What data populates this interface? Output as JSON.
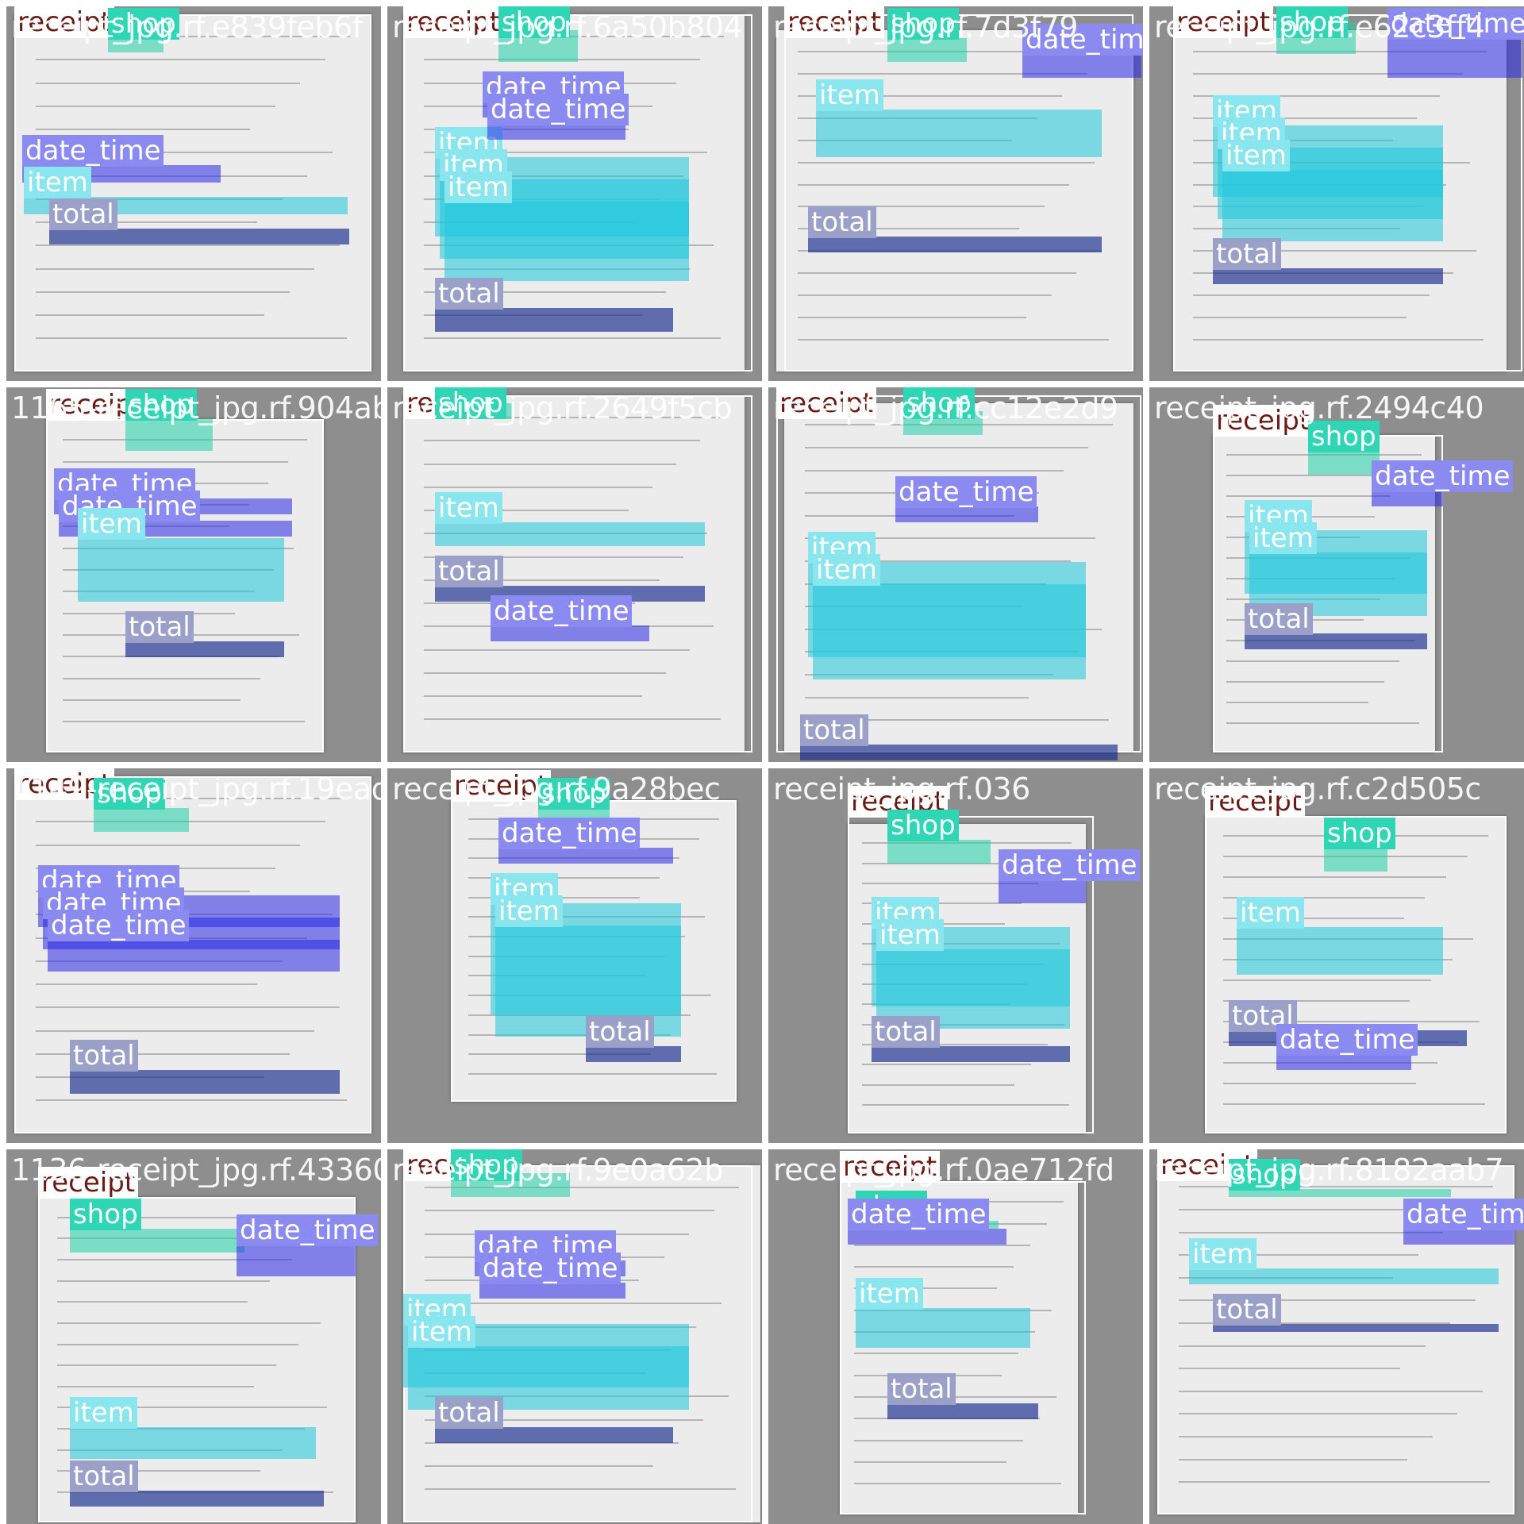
{
  "colors": {
    "receipt": "#ffffff",
    "shop": "#2fd6b6",
    "date_time": "#2828e6",
    "item": "#1ec8dc",
    "total": "#14288c"
  },
  "class_labels": [
    "receipt",
    "shop",
    "date_time",
    "item",
    "total"
  ],
  "tiles": [
    {
      "filename": "receipt_jpg.rf.e839feb6f",
      "labels": [
        "receipt",
        "shop",
        "date_time",
        "item",
        "total"
      ]
    },
    {
      "filename": "receipt_jpg.rf.6a50b804",
      "labels": [
        "receipt",
        "shop",
        "date_time",
        "item",
        "item",
        "item",
        "total",
        "date_time"
      ]
    },
    {
      "filename": "receipt_jpg.rf.7d3f79",
      "labels": [
        "receipt",
        "shop",
        "date_time",
        "item",
        "total"
      ]
    },
    {
      "filename": "receipt_jpg.rf.e62c3ff4",
      "labels": [
        "receipt",
        "shop",
        "date_time",
        "item",
        "item",
        "item",
        "total"
      ]
    },
    {
      "filename": "1165-receipt_jpg.rf.904ab047",
      "labels": [
        "receipt",
        "shop",
        "date_time",
        "date_time",
        "item",
        "total"
      ]
    },
    {
      "filename": "receipt_jpg.rf.2649f5cb",
      "labels": [
        "receipt",
        "shop",
        "item",
        "total",
        "date_time"
      ]
    },
    {
      "filename": "receipt_jpg.rf.cc12e2d9",
      "labels": [
        "receipt",
        "shop",
        "date_time",
        "item",
        "item",
        "total"
      ]
    },
    {
      "filename": "receipt_jpg.rf.2494c40",
      "labels": [
        "receipt",
        "shop",
        "date_time",
        "item",
        "item",
        "total"
      ]
    },
    {
      "filename": "1149-receipt_jpg.rf.19eadca",
      "labels": [
        "receipt",
        "shop",
        "date_time",
        "date_time",
        "date_time",
        "total"
      ]
    },
    {
      "filename": "receipt_jpg.rf.9a28bec",
      "labels": [
        "receipt",
        "shop",
        "date_time",
        "item",
        "item",
        "total"
      ]
    },
    {
      "filename": "receipt_jpg.rf.036",
      "labels": [
        "receipt",
        "shop",
        "date_time",
        "item",
        "item",
        "total"
      ]
    },
    {
      "filename": "receipt_jpg.rf.c2d505c",
      "labels": [
        "receipt",
        "shop",
        "item",
        "total",
        "date_time"
      ]
    },
    {
      "filename": "1136-receipt_jpg.rf.433606e",
      "labels": [
        "receipt",
        "shop",
        "date_time",
        "item",
        "total"
      ]
    },
    {
      "filename": "receipt_jpg.rf.9e0a62b",
      "labels": [
        "receipt",
        "shop",
        "date_time",
        "item",
        "item",
        "total",
        "date_time"
      ]
    },
    {
      "filename": "receipt_jpg.rf.0ae712fd",
      "labels": [
        "receipt",
        "shop",
        "date_time",
        "item",
        "total"
      ]
    },
    {
      "filename": "receipt_jpg.rf.8182aab7",
      "labels": [
        "receipt",
        "shop",
        "date_time",
        "item",
        "total"
      ]
    }
  ]
}
